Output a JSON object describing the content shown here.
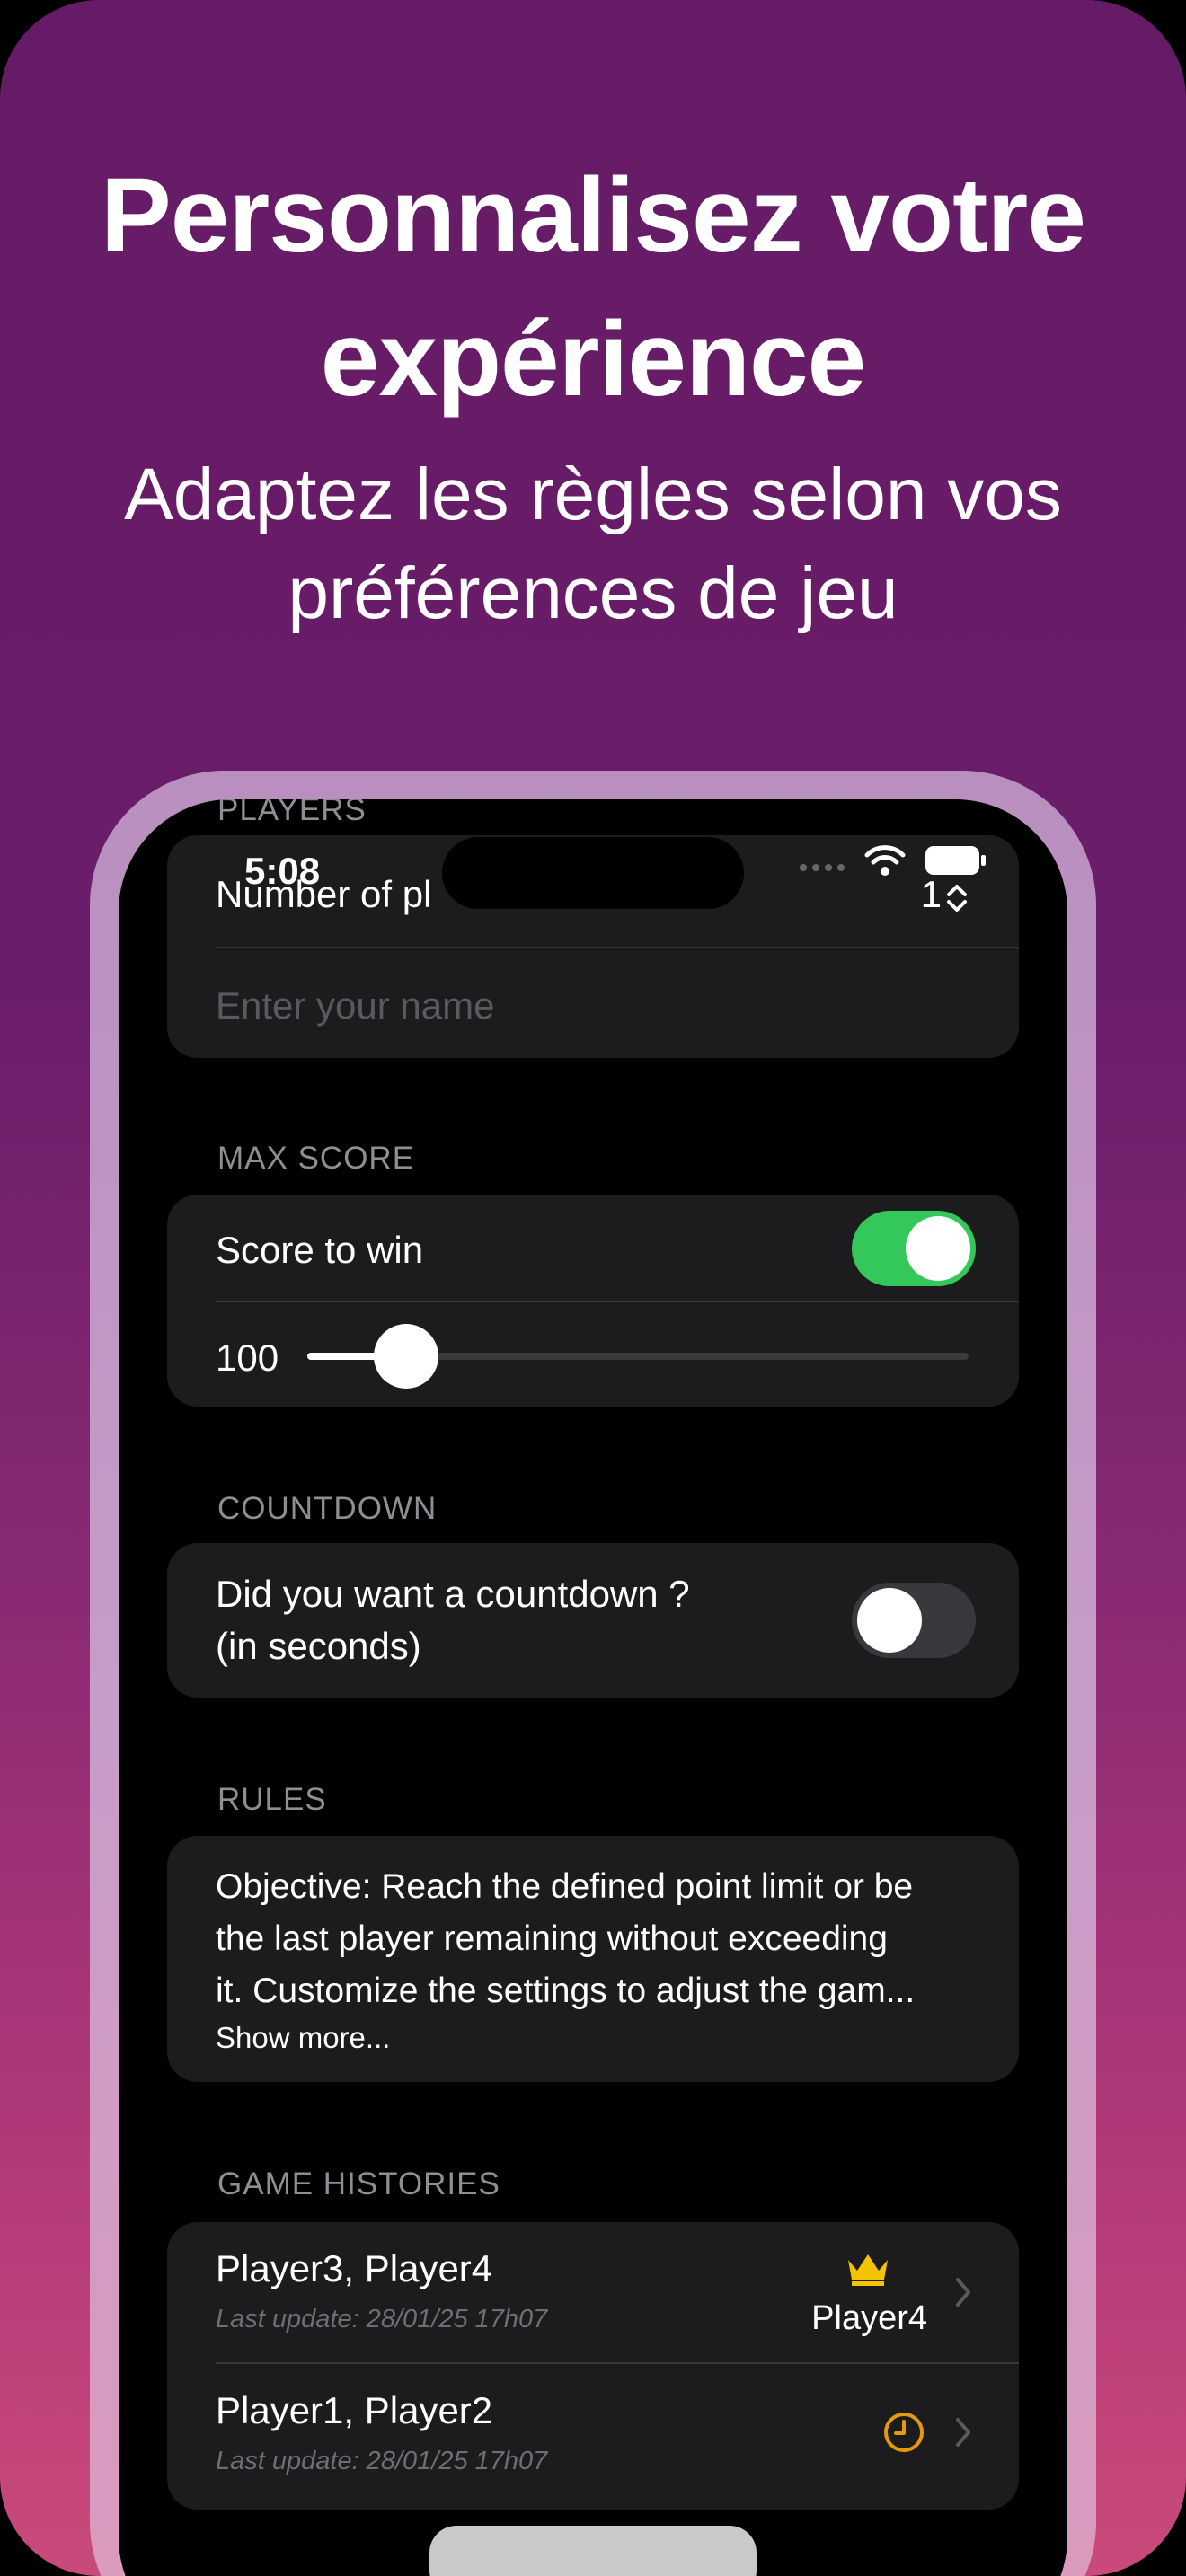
{
  "promo": {
    "headline_line1": "Personnalisez votre",
    "headline_line2": "expérience",
    "subline_line1": "Adaptez les règles selon vos",
    "subline_line2": "préférences de jeu"
  },
  "status_bar": {
    "time": "5:08"
  },
  "players": {
    "section_label": "PLAYERS",
    "number_label": "Number of pl",
    "number_value": "1",
    "name_placeholder": "Enter your name"
  },
  "max_score": {
    "section_label": "MAX SCORE",
    "toggle_label": "Score to win",
    "toggle_on": true,
    "slider_value": "100",
    "slider_fraction": 0.15
  },
  "countdown": {
    "section_label": "COUNTDOWN",
    "toggle_label_line1": "Did you want a countdown ?",
    "toggle_label_line2": "(in seconds)",
    "toggle_on": false
  },
  "rules": {
    "section_label": "RULES",
    "text_line1": "Objective: Reach the defined point limit or be",
    "text_line2": "the last player remaining without exceeding",
    "text_line3": "it. Customize the settings to adjust the gam...",
    "show_more": "Show more..."
  },
  "game_histories": {
    "section_label": "GAME HISTORIES",
    "items": [
      {
        "players": "Player3, Player4",
        "updated": "Last update: 28/01/25 17h07",
        "winner": "Player4",
        "icon": "crown-icon"
      },
      {
        "players": "Player1, Player2",
        "updated": "Last update: 28/01/25 17h07",
        "winner": "",
        "icon": "clock-icon"
      }
    ]
  },
  "colors": {
    "accent_green": "#34c759",
    "crown_gold": "#f5c400",
    "clock_orange": "#e69a0a"
  }
}
